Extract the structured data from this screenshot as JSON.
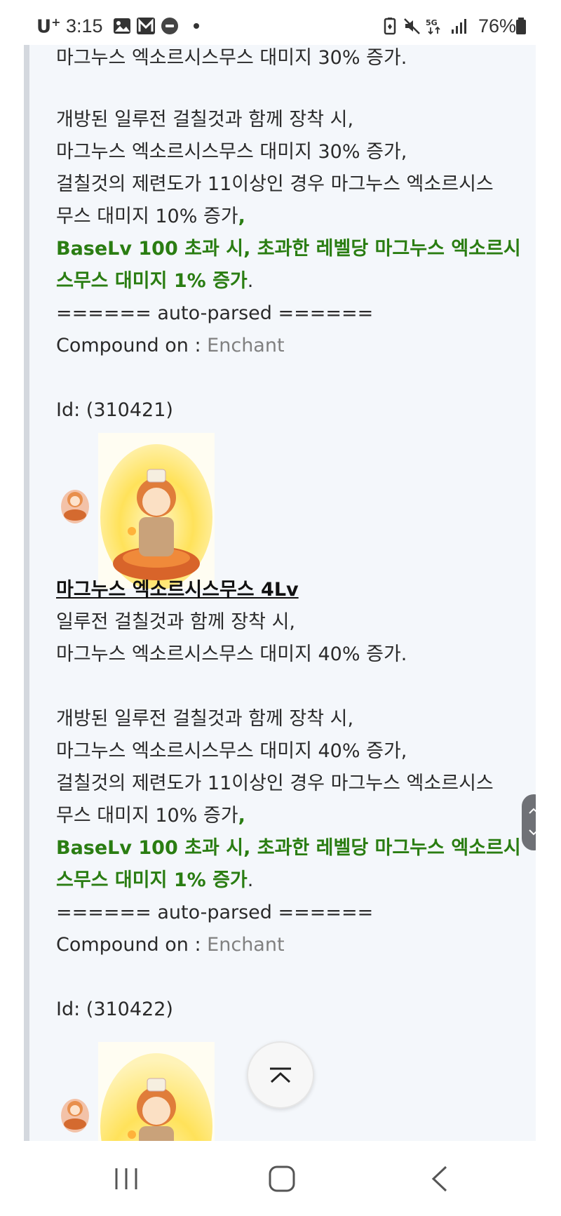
{
  "status_bar": {
    "carrier": "U",
    "carrier_sup": "+",
    "time": "3:15",
    "battery": "76%",
    "network": "5G"
  },
  "entry_top": {
    "line1": "마그누스 엑소르시스무스 대미지 30% 증가.",
    "line2": "개방된 일루전 걸칠것과 함께 장착 시,",
    "line3": "마그누스 엑소르시스무스 대미지 30% 증가,",
    "line4": "걸칠것의 제련도가 11이상인 경우 마그누스 엑소르시스",
    "line5a": "무스 대미지 10% 증가",
    "line5b": ",",
    "green1": "BaseLv 100 초과 시, 초과한 레벨당 마그누스 엑소르시",
    "green2": "스무스 대미지 1% 증가",
    "period": ".",
    "parsed": "====== auto-parsed ======",
    "compound_label": "Compound on : ",
    "compound_value": "Enchant",
    "id": "Id: (310421)"
  },
  "entry_4": {
    "title": "마그누스 엑소르시스무스 4Lv",
    "line1": "일루전 걸칠것과 함께 장착 시,",
    "line2": "마그누스 엑소르시스무스 대미지 40% 증가.",
    "line3": "개방된 일루전 걸칠것과 함께 장착 시,",
    "line4": "마그누스 엑소르시스무스 대미지 40% 증가,",
    "line5": "걸칠것의 제련도가 11이상인 경우 마그누스 엑소르시스",
    "line6a": "무스 대미지 10% 증가",
    "line6b": ",",
    "green1": "BaseLv 100 초과 시, 초과한 레벨당 마그누스 엑소르시",
    "green2": "스무스 대미지 1% 증가",
    "period": ".",
    "parsed": "====== auto-parsed ======",
    "compound_label": "Compound on : ",
    "compound_value": "Enchant",
    "id": "Id: (310422)"
  },
  "colors": {
    "green": "#2a7d12",
    "gray": "#808080",
    "background": "#f4f7fb"
  },
  "icons": {
    "scroll_up": "chevron-up-icon",
    "scroll_down": "chevron-down-icon",
    "to_top": "back-to-top-icon",
    "recents": "recent-apps-icon",
    "home": "home-icon",
    "back": "back-icon"
  }
}
